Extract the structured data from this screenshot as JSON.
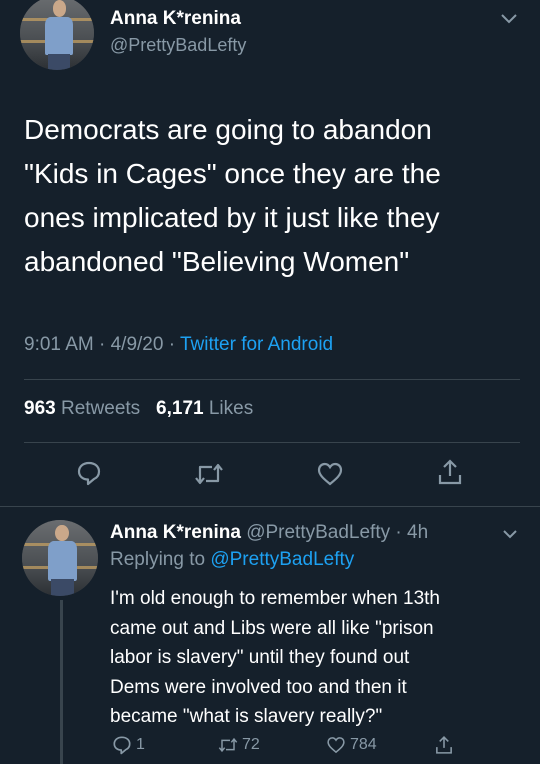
{
  "tweet": {
    "author_name": "Anna K*renina",
    "author_handle": "@PrettyBadLefty",
    "lines": [
      "Democrats are going to abandon",
      "\"Kids in Cages\" once they are the",
      "ones implicated by it just like they",
      "abandoned \"Believing Women\""
    ],
    "time": "9:01 AM",
    "date": "4/9/20",
    "source": "Twitter for Android",
    "retweets_count": "963",
    "retweets_label": "Retweets",
    "likes_count": "6,171",
    "likes_label": "Likes"
  },
  "reply": {
    "author_name": "Anna K*renina",
    "author_handle": "@PrettyBadLefty",
    "age": "4h",
    "replying_label": "Replying to",
    "replying_handle": "@PrettyBadLefty",
    "lines": [
      "I'm old enough to remember when 13th",
      "came out and Libs were all like \"prison",
      "labor is slavery\" until they found out",
      "Dems were involved too and then it",
      "became \"what is slavery really?\""
    ],
    "reply_count": "1",
    "retweet_count": "72",
    "like_count": "784"
  },
  "icons": {
    "reply": "comment-bubble-icon",
    "retweet": "retweet-icon",
    "like": "heart-icon",
    "share": "share-icon",
    "more": "chevron-down-icon"
  },
  "colors": {
    "background": "#15202b",
    "accent": "#1da1f2",
    "muted": "#8899a6",
    "divider": "#38444d"
  }
}
